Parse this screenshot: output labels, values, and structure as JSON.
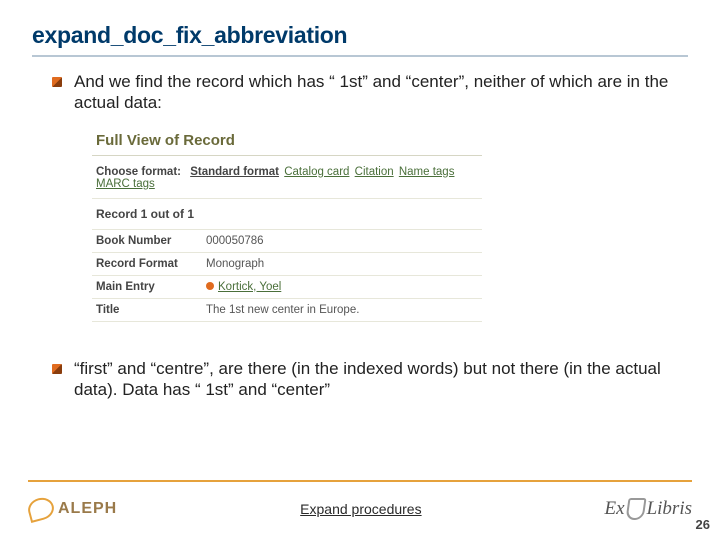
{
  "title": "expand_doc_fix_abbreviation",
  "bullet1": "And we find the record which has “ 1st” and “center”, neither of which are in the actual data:",
  "bullet2": "“first” and “centre”, are there (in the indexed words) but not there (in the actual data). Data has “ 1st” and “center”",
  "record": {
    "header": "Full View of Record",
    "choose_format_label": "Choose format:",
    "formats": {
      "selected": "Standard format",
      "links": [
        "Catalog card",
        "Citation",
        "Name tags",
        "MARC tags"
      ]
    },
    "count_line": "Record 1 out of 1",
    "fields": [
      {
        "label": "Book Number",
        "value": "000050786",
        "link": false
      },
      {
        "label": "Record Format",
        "value": "Monograph",
        "link": false
      },
      {
        "label": "Main Entry",
        "value": "Kortick, Yoel",
        "link": true,
        "dot": true
      },
      {
        "label": "Title",
        "value": "The 1st new center in Europe.",
        "link": false
      }
    ]
  },
  "footer": {
    "aleph": "ALEPH",
    "center": "Expand procedures",
    "exlibris_a": "Ex",
    "exlibris_b": "Libris",
    "page": "26"
  }
}
